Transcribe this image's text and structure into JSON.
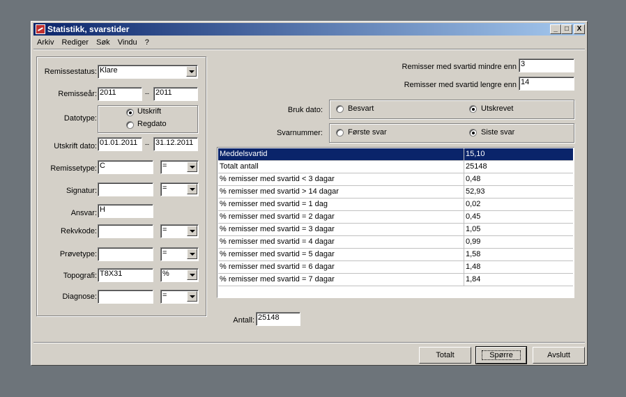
{
  "window": {
    "title": "Statistikk, svarstider",
    "minimize": "_",
    "maximize": "□",
    "close": "X"
  },
  "menu": [
    "Arkiv",
    "Rediger",
    "Søk",
    "Vindu",
    "?"
  ],
  "filters": {
    "remissestatus": {
      "label": "Remissestatus:",
      "value": "Klare"
    },
    "remisseaar": {
      "label": "Remisseår:",
      "from": "2011",
      "sep": "--",
      "to": "2011"
    },
    "datotype": {
      "label": "Datotype:",
      "options": [
        "Utskrift",
        "Regdato"
      ],
      "selected": "Utskrift"
    },
    "utskrift_dato": {
      "label": "Utskrift dato:",
      "from": "01.01.2011",
      "sep": "--",
      "to": "31.12.2011"
    },
    "remissetype": {
      "label": "Remissetype:",
      "value": "C",
      "op": "="
    },
    "signatur": {
      "label": "Signatur:",
      "value": "",
      "op": "="
    },
    "ansvar": {
      "label": "Ansvar:",
      "value": "H"
    },
    "rekvkode": {
      "label": "Rekvkode:",
      "value": "",
      "op": "="
    },
    "provetype": {
      "label": "Prøvetype:",
      "value": "",
      "op": "="
    },
    "topografi": {
      "label": "Topografi:",
      "value": "T8X31",
      "op": "%"
    },
    "diagnose": {
      "label": "Diagnose:",
      "value": "",
      "op": "="
    }
  },
  "thresholds": {
    "less_label": "Remisser med svartid mindre enn",
    "less_value": "3",
    "more_label": "Remisser med svartid lengre enn",
    "more_value": "14"
  },
  "bruk_dato": {
    "label": "Bruk dato:",
    "options": [
      "Besvart",
      "Utskrevet"
    ],
    "selected": "Utskrevet"
  },
  "svarnummer": {
    "label": "Svarnummer:",
    "options": [
      "Første svar",
      "Siste svar"
    ],
    "selected": "Siste svar"
  },
  "results": [
    {
      "label": "Meddelsvartid",
      "value": "15,10"
    },
    {
      "label": "Totalt antall",
      "value": "25148"
    },
    {
      "label": "% remisser med svartid < 3 dagar",
      "value": "0,48"
    },
    {
      "label": "% remisser med svartid > 14 dagar",
      "value": "52,93"
    },
    {
      "label": "% remisser med svartid = 1 dag",
      "value": "0,02"
    },
    {
      "label": "% remisser med svartid = 2 dagar",
      "value": "0,45"
    },
    {
      "label": "% remisser med svartid = 3 dagar",
      "value": "1,05"
    },
    {
      "label": "% remisser med svartid = 4 dagar",
      "value": "0,99"
    },
    {
      "label": "% remisser med svartid = 5 dagar",
      "value": "1,58"
    },
    {
      "label": "% remisser med svartid = 6 dagar",
      "value": "1,48"
    },
    {
      "label": "% remisser med svartid = 7 dagar",
      "value": "1,84"
    }
  ],
  "antall": {
    "label": "Antall:",
    "value": "25148"
  },
  "buttons": {
    "totalt": "Totalt",
    "sporre": "Spørre",
    "avslutt": "Avslutt"
  },
  "colors": {
    "title_start": "#0a246a",
    "title_end": "#a6caf0",
    "selection": "#0a246a",
    "face": "#d4d0c8",
    "desktop": "#6d747a"
  }
}
